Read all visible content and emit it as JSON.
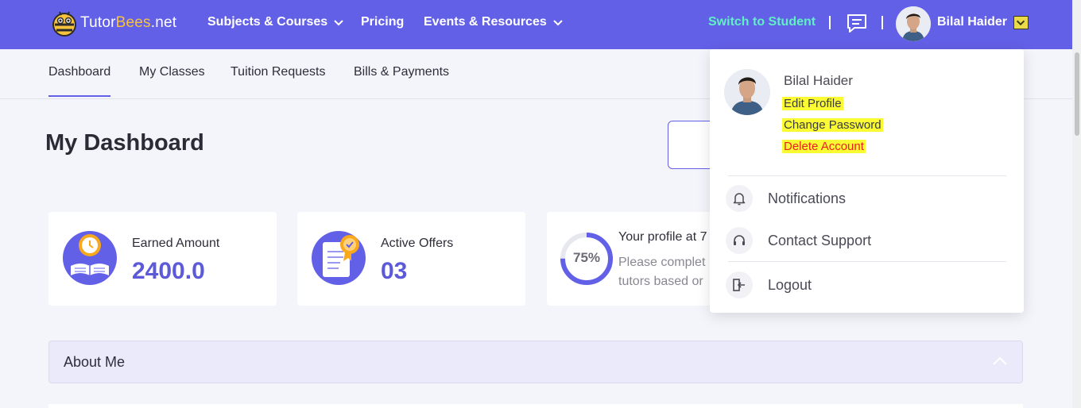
{
  "brand": {
    "name_prefix": "Tutor",
    "name_highlight": "Bees",
    "name_suffix": ".net"
  },
  "nav": [
    {
      "label": "Subjects & Courses",
      "has_dropdown": true
    },
    {
      "label": "Pricing",
      "has_dropdown": false
    },
    {
      "label": "Events & Resources",
      "has_dropdown": true
    }
  ],
  "header": {
    "switch_label": "Switch to Student",
    "separator": "|",
    "user_name": "Bilal Haider",
    "icons": [
      "chat-icon",
      "avatar",
      "chevron-down-icon"
    ]
  },
  "tabs": [
    {
      "label": "Dashboard",
      "active": true
    },
    {
      "label": "My Classes",
      "active": false
    },
    {
      "label": "Tuition Requests",
      "active": false
    },
    {
      "label": "Bills & Payments",
      "active": false
    }
  ],
  "main": {
    "title": "My Dashboard",
    "cards": [
      {
        "label": "Earned Amount",
        "value": "2400.0",
        "icon": "book-clock-icon"
      },
      {
        "label": "Active Offers",
        "value": "03",
        "icon": "certificate-icon"
      }
    ],
    "profile_card": {
      "percent_text": "75%",
      "percent_value": 75,
      "title": "Your profile at 7",
      "desc_line1": "Please complet",
      "desc_line2": "tutors based or"
    },
    "about_title": "About Me"
  },
  "dropdown": {
    "name": "Bilal Haider",
    "edit_profile": "Edit Profile",
    "change_password": "Change Password",
    "delete_account": "Delete Account",
    "items": [
      {
        "label": "Notifications",
        "icon": "bell-icon"
      },
      {
        "label": "Contact Support",
        "icon": "headset-icon"
      },
      {
        "label": "Logout",
        "icon": "logout-icon"
      }
    ]
  },
  "colors": {
    "primary": "#6360e8",
    "switch_link": "#5ff0c4",
    "value": "#5c5ad8",
    "highlight": "#fbfb33",
    "danger": "#ee1f1f"
  }
}
